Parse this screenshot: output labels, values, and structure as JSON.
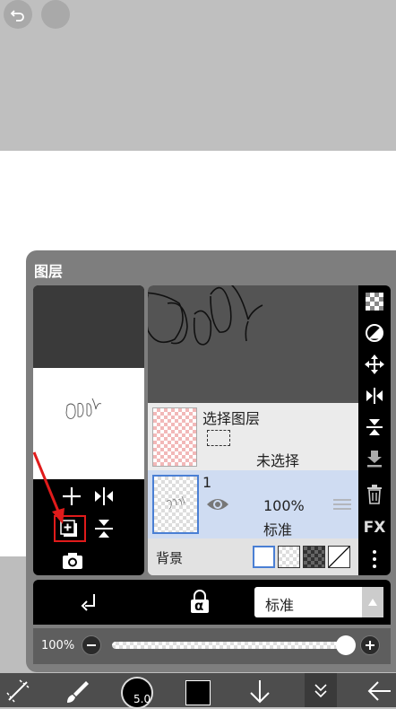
{
  "panel": {
    "title": "图层"
  },
  "layers": {
    "selection": {
      "title": "选择图层",
      "status": "未选择"
    },
    "layer1": {
      "name": "1",
      "opacity": "100%",
      "blend": "标准"
    },
    "background": {
      "label": "背景"
    }
  },
  "sidebar_tools": [
    "checker-icon",
    "contrast-icon",
    "move-icon",
    "flip-horizontal-icon",
    "flip-vertical-icon",
    "merge-down-icon",
    "trash-icon",
    "fx-icon",
    "more-icon"
  ],
  "fx_label": "FX",
  "blend": {
    "mode": "标准",
    "alpha_label": "α"
  },
  "opacity": {
    "label": "100%",
    "value": 1.0
  },
  "brush": {
    "size": "5.0"
  },
  "colors": {
    "accent": "#4a7fd4",
    "highlight_box": "#e01b1b",
    "arrow": "#e01b1b",
    "layer_selected": "#cfdcf2"
  }
}
